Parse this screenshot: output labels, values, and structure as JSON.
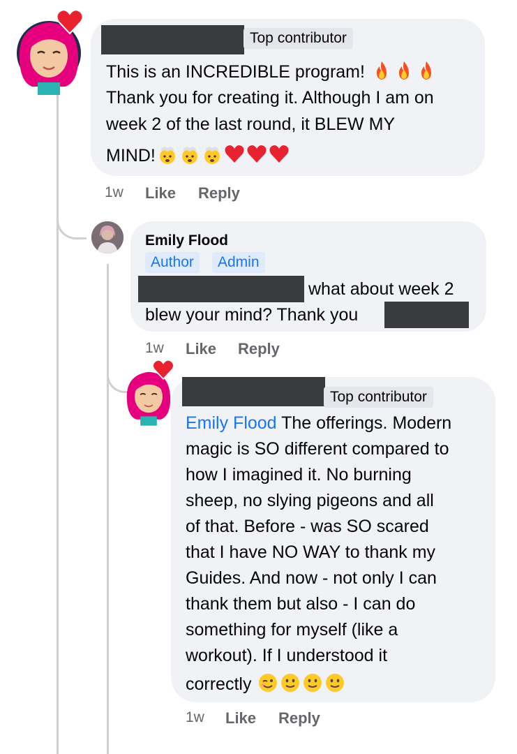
{
  "comments": [
    {
      "badge": "Top contributor",
      "lines": [
        "This is an INCREDIBLE program!",
        "Thank you for creating it. Although I am on",
        "week 2 of the last round, it BLEW MY",
        "MIND!"
      ],
      "time": "1w",
      "like": "Like",
      "reply": "Reply",
      "emoji_line1": [
        "fire",
        "fire",
        "fire"
      ],
      "emoji_line4": [
        "exploding-head",
        "exploding-head",
        "exploding-head",
        "red-heart",
        "red-heart",
        "red-heart"
      ]
    },
    {
      "author": "Emily Flood",
      "badges": [
        "Author",
        "Admin"
      ],
      "line1": "what about week 2",
      "line2": "blew your mind? Thank you",
      "time": "1w",
      "like": "Like",
      "reply": "Reply"
    },
    {
      "badge": "Top contributor",
      "mention": "Emily Flood",
      "lines": [
        " The offerings. Modern",
        "magic is SO different compared to",
        "how I imagined it. No burning",
        "sheep, no slying pigeons and all",
        "of that. Before - was SO scared",
        "that I have NO WAY to thank my",
        "Guides. And now - not only I can",
        "thank them but also - I can do",
        "something for myself (like a",
        "workout). If I understood it",
        "correctly"
      ],
      "emoji_last": [
        "winking-face",
        "slightly-smiling-face",
        "slightly-smiling-face",
        "slightly-smiling-face"
      ],
      "time": "1w",
      "like": "Like",
      "reply": "Reply"
    }
  ],
  "colors": {
    "bubble": "#f0f2f5",
    "redaction": "#3a3b3c",
    "link": "#1876f2",
    "meta": "#65676b",
    "line": "#ced0d4"
  }
}
